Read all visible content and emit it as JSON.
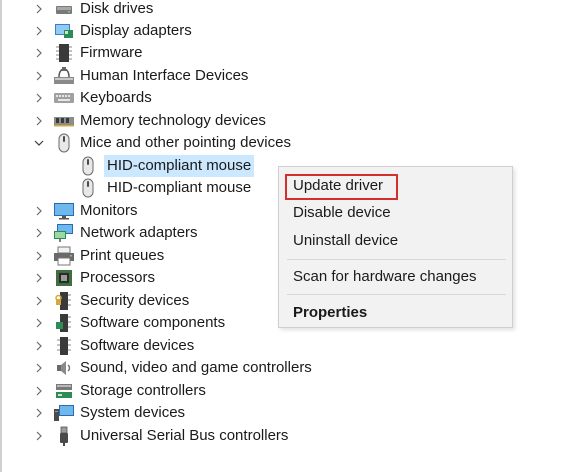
{
  "tree": {
    "categories": [
      {
        "label": "Disk drives",
        "icon": "disk-drive-icon"
      },
      {
        "label": "Display adapters",
        "icon": "display-adapter-icon"
      },
      {
        "label": "Firmware",
        "icon": "firmware-icon"
      },
      {
        "label": "Human Interface Devices",
        "icon": "hid-icon"
      },
      {
        "label": "Keyboards",
        "icon": "keyboard-icon"
      },
      {
        "label": "Memory technology devices",
        "icon": "memory-icon"
      },
      {
        "label": "Mice and other pointing devices",
        "icon": "mouse-icon",
        "expanded": true
      },
      {
        "label": "Monitors",
        "icon": "monitor-icon"
      },
      {
        "label": "Network adapters",
        "icon": "network-adapter-icon"
      },
      {
        "label": "Print queues",
        "icon": "printer-icon"
      },
      {
        "label": "Processors",
        "icon": "processor-icon"
      },
      {
        "label": "Security devices",
        "icon": "security-device-icon"
      },
      {
        "label": "Software components",
        "icon": "software-component-icon"
      },
      {
        "label": "Software devices",
        "icon": "software-device-icon"
      },
      {
        "label": "Sound, video and game controllers",
        "icon": "speaker-icon"
      },
      {
        "label": "Storage controllers",
        "icon": "storage-controller-icon"
      },
      {
        "label": "System devices",
        "icon": "system-device-icon"
      },
      {
        "label": "Universal Serial Bus controllers",
        "icon": "usb-icon"
      }
    ],
    "mice_children": [
      {
        "label": "HID-compliant mouse",
        "selected": true
      },
      {
        "label": "HID-compliant mouse",
        "selected": false
      }
    ]
  },
  "context_menu": {
    "items": [
      "Update driver",
      "Disable device",
      "Uninstall device",
      "Scan for hardware changes",
      "Properties"
    ],
    "highlighted_item": "Update driver",
    "highlight_color": "#d32f2f"
  },
  "colors": {
    "selection": "#cce8ff",
    "menu_background": "#f2f2f2"
  }
}
